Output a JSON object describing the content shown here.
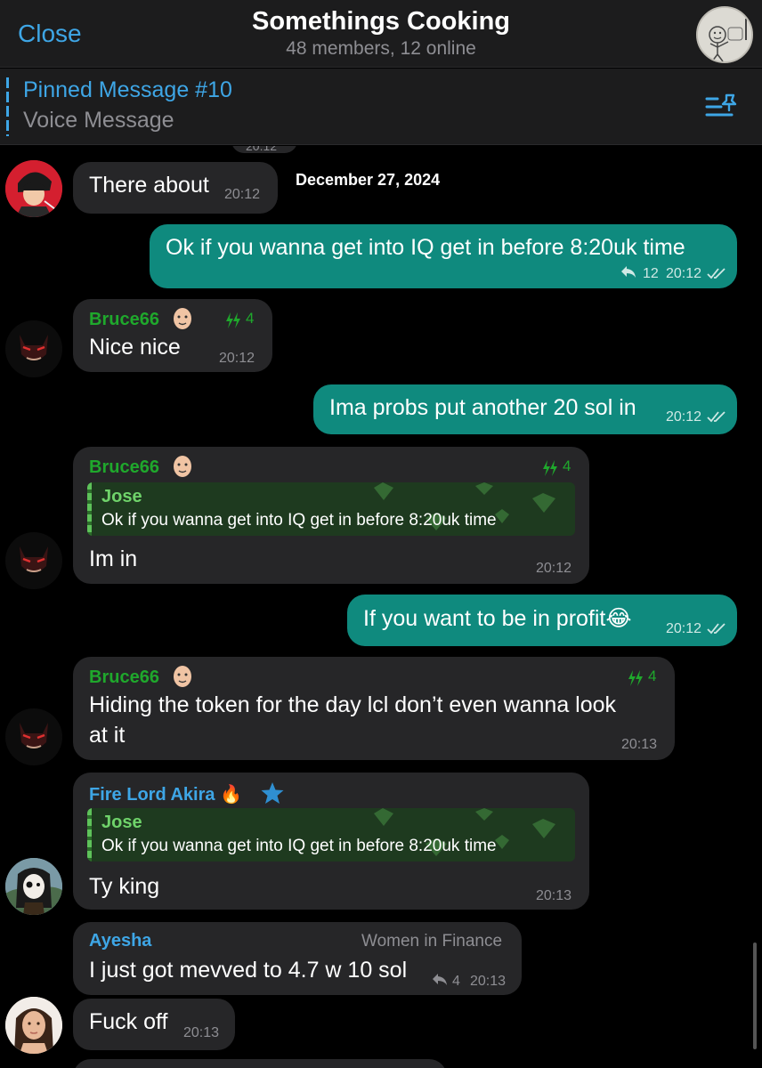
{
  "header": {
    "close_label": "Close",
    "title": "Somethings Cooking",
    "subtitle": "48 members, 12 online"
  },
  "pinned": {
    "title": "Pinned Message #10",
    "subtitle": "Voice Message"
  },
  "chat": {
    "ghost_time": "20:12",
    "date": "December 27, 2024",
    "messages": [
      {
        "text": "There about",
        "time": "20:12"
      },
      {
        "text": "Ok if you wanna get into IQ get in before 8:20uk time",
        "replies": "12",
        "time": "20:12"
      },
      {
        "sender": "Bruce66",
        "boost": "4",
        "text": "Nice nice",
        "time": "20:12"
      },
      {
        "text": "Ima probs put another 20 sol in",
        "time": "20:12"
      },
      {
        "sender": "Bruce66",
        "boost": "4",
        "reply_name": "Jose",
        "reply_text": "Ok if you wanna get into IQ get in before 8:20uk time",
        "text": "Im in",
        "time": "20:12"
      },
      {
        "text": "If you want to be in profit😂",
        "time": "20:12"
      },
      {
        "sender": "Bruce66",
        "boost": "4",
        "text_line1": "Hiding the token for the day lcl don’t even wanna look",
        "text_line2": "at it",
        "time": "20:13"
      },
      {
        "sender": "Fire Lord Akira 🔥",
        "reply_name": "Jose",
        "reply_text": "Ok if you wanna get into IQ get in before 8:20uk time",
        "text": "Ty king",
        "time": "20:13"
      },
      {
        "sender": "Ayesha",
        "tag": "Women in Finance",
        "text": "I just got mevved to 4.7 w 10 sol",
        "replies": "4",
        "time": "20:13"
      },
      {
        "text": "Fuck off",
        "time": "20:13"
      }
    ]
  },
  "colors": {
    "accent": "#3ea6e6",
    "outgoing_bubble": "#0f8a7e",
    "incoming_bubble": "#262628",
    "sender_green": "#1fa82c"
  }
}
